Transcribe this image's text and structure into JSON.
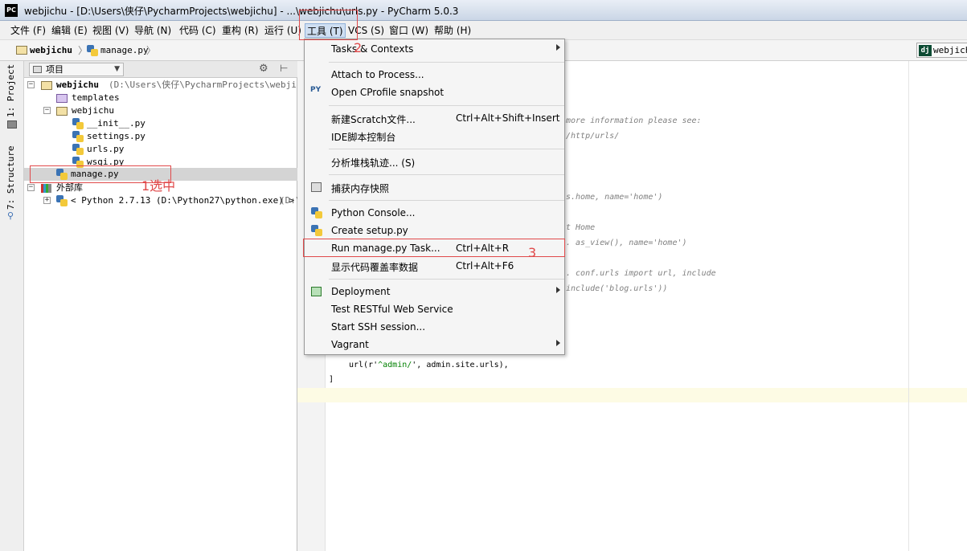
{
  "window": {
    "app_icon": "PC",
    "title": "webjichu - [D:\\Users\\侠仔\\PycharmProjects\\webjichu] - ...\\webjichu\\urls.py - PyCharm 5.0.3"
  },
  "menubar": {
    "items": [
      "文件 (F)",
      "编辑 (E)",
      "视图 (V)",
      "导航 (N)",
      "代码 (C)",
      "重构 (R)",
      "运行 (U)",
      "工具 (T)",
      "VCS (S)",
      "窗口 (W)",
      "帮助 (H)"
    ],
    "active_index": 7
  },
  "breadcrumb": {
    "items": [
      "webjichu",
      "manage.py"
    ],
    "right_tab": "webjichu"
  },
  "tool_strip": {
    "project_tab": "1: Project",
    "structure_tab": "7: Structure"
  },
  "project_panel": {
    "view_label": "项目",
    "tree": [
      {
        "label": "webjichu",
        "sub": "(D:\\Users\\侠仔\\PycharmProjects\\webjichu)",
        "type": "folder"
      },
      {
        "label": "templates",
        "type": "folder-purple"
      },
      {
        "label": "webjichu",
        "type": "folder"
      },
      {
        "label": "__init__.py",
        "type": "py"
      },
      {
        "label": "settings.py",
        "type": "py"
      },
      {
        "label": "urls.py",
        "type": "py"
      },
      {
        "label": "wsgi.py",
        "type": "py"
      },
      {
        "label": "manage.py",
        "type": "py",
        "selected": true
      },
      {
        "label": "外部库",
        "type": "lib"
      },
      {
        "label": "< Python 2.7.13 (D:\\Python27\\python.exe) >",
        "sub": "(D:\\",
        "type": "py"
      }
    ]
  },
  "editor": {
    "fragments": [
      "more information please see:",
      "/http/urls/",
      "s.home, name='home')",
      "t Home",
      ". as_view(), name='home')",
      ". conf.urls import url, include",
      "include('blog.urls'))"
    ],
    "code_line": [
      "url(r'",
      "^admin/",
      "', admin.site.urls),"
    ],
    "closing": "]"
  },
  "dropdown": {
    "items": [
      {
        "label": "Tasks & Contexts",
        "submenu": true
      },
      {
        "label": "Attach to Process..."
      },
      {
        "label": "Open CProfile snapshot",
        "icon": "cprofile-icon"
      },
      {
        "label": "新建Scratch文件...",
        "shortcut": "Ctrl+Alt+Shift+Insert"
      },
      {
        "label": "IDE脚本控制台"
      },
      {
        "label": "分析堆栈轨迹... (S)"
      },
      {
        "label": "捕获内存快照",
        "icon": "memory-snapshot-icon"
      },
      {
        "label": "Python Console...",
        "icon": "python-icon"
      },
      {
        "label": "Create setup.py",
        "icon": "python-icon"
      },
      {
        "label": "Run manage.py Task...",
        "shortcut": "Ctrl+Alt+R"
      },
      {
        "label": "显示代码覆盖率数据",
        "shortcut": "Ctrl+Alt+F6"
      },
      {
        "label": "Deployment",
        "submenu": true,
        "icon": "deployment-icon"
      },
      {
        "label": "Test RESTful Web Service"
      },
      {
        "label": "Start SSH session..."
      },
      {
        "label": "Vagrant",
        "submenu": true
      }
    ]
  },
  "annotations": {
    "step1": "1选中",
    "step2": "2",
    "step3": "3",
    "color": "#e0494a"
  }
}
